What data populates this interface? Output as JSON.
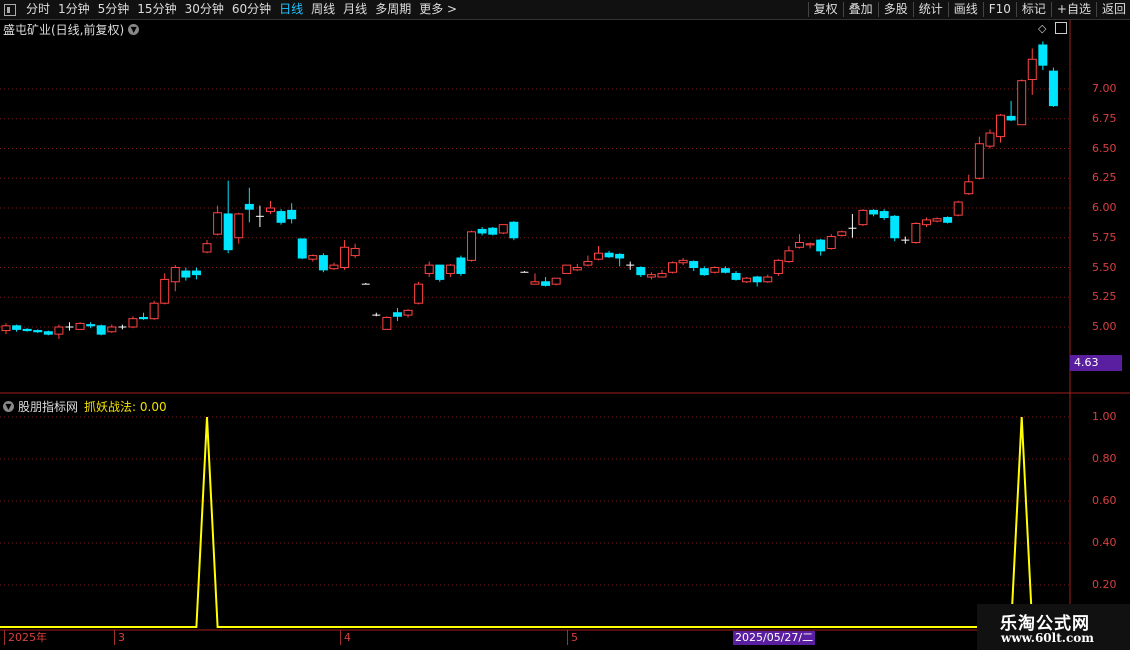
{
  "toolbar": {
    "periods": [
      "分时",
      "1分钟",
      "5分钟",
      "15分钟",
      "30分钟",
      "60分钟",
      "日线",
      "周线",
      "月线",
      "多周期",
      "更多 >"
    ],
    "active": "日线",
    "actions": [
      "复权",
      "叠加",
      "多股",
      "统计",
      "画线",
      "F10",
      "标记",
      "+自选",
      "返回"
    ]
  },
  "chart": {
    "stock_name": "盛屯矿业(日线,前复权)",
    "last_price_tag": "4.63",
    "price_axis": [
      "7.00",
      "6.75",
      "6.50",
      "6.25",
      "6.00",
      "5.75",
      "5.50",
      "5.25",
      "5.00"
    ],
    "indicator_name": "股朋指标网",
    "indicator_signal": "抓妖战法: 0.00",
    "indicator_axis": [
      "1.00",
      "0.80",
      "0.60",
      "0.40",
      "0.20"
    ],
    "date_labels": [
      "2025年",
      "3",
      "4",
      "5"
    ],
    "date_highlight": "2025/05/27/二",
    "colors": {
      "up": "#ff4444",
      "down": "#00e5ff",
      "signal": "#ffff00",
      "grid": "#7a1a1a"
    }
  },
  "chart_data": [
    {
      "type": "candlestick",
      "title": "盛屯矿业(日线,前复权)",
      "ylim": [
        4.63,
        7.35
      ],
      "candles": [
        {
          "o": 4.97,
          "c": 5.01,
          "h": 5.03,
          "l": 4.94
        },
        {
          "o": 5.01,
          "c": 4.98,
          "h": 5.02,
          "l": 4.96
        },
        {
          "o": 4.98,
          "c": 4.97,
          "h": 4.99,
          "l": 4.96
        },
        {
          "o": 4.97,
          "c": 4.96,
          "h": 4.98,
          "l": 4.95
        },
        {
          "o": 4.96,
          "c": 4.94,
          "h": 4.97,
          "l": 4.93
        },
        {
          "o": 4.94,
          "c": 5.0,
          "h": 5.02,
          "l": 4.9
        },
        {
          "o": 5.0,
          "c": 5.0,
          "h": 5.04,
          "l": 4.97
        },
        {
          "o": 4.98,
          "c": 5.03,
          "h": 5.04,
          "l": 4.98
        },
        {
          "o": 5.02,
          "c": 5.01,
          "h": 5.04,
          "l": 4.99
        },
        {
          "o": 5.01,
          "c": 4.94,
          "h": 5.02,
          "l": 4.93
        },
        {
          "o": 4.96,
          "c": 5.0,
          "h": 5.02,
          "l": 4.95
        },
        {
          "o": 5.0,
          "c": 5.0,
          "h": 5.02,
          "l": 4.98
        },
        {
          "o": 5.0,
          "c": 5.07,
          "h": 5.09,
          "l": 4.99
        },
        {
          "o": 5.08,
          "c": 5.07,
          "h": 5.12,
          "l": 5.06
        },
        {
          "o": 5.07,
          "c": 5.2,
          "h": 5.22,
          "l": 5.06
        },
        {
          "o": 5.2,
          "c": 5.4,
          "h": 5.45,
          "l": 5.19
        },
        {
          "o": 5.38,
          "c": 5.5,
          "h": 5.52,
          "l": 5.3
        },
        {
          "o": 5.47,
          "c": 5.42,
          "h": 5.5,
          "l": 5.39
        },
        {
          "o": 5.47,
          "c": 5.44,
          "h": 5.5,
          "l": 5.4
        },
        {
          "o": 5.63,
          "c": 5.7,
          "h": 5.73,
          "l": 5.62
        },
        {
          "o": 5.78,
          "c": 5.96,
          "h": 6.02,
          "l": 5.77
        },
        {
          "o": 5.95,
          "c": 5.65,
          "h": 6.23,
          "l": 5.62
        },
        {
          "o": 5.75,
          "c": 5.95,
          "h": 5.96,
          "l": 5.7
        },
        {
          "o": 6.03,
          "c": 5.99,
          "h": 6.17,
          "l": 5.88
        },
        {
          "o": 5.93,
          "c": 5.93,
          "h": 6.02,
          "l": 5.84
        },
        {
          "o": 5.97,
          "c": 6.0,
          "h": 6.06,
          "l": 5.95
        },
        {
          "o": 5.97,
          "c": 5.88,
          "h": 5.99,
          "l": 5.86
        },
        {
          "o": 5.98,
          "c": 5.91,
          "h": 6.04,
          "l": 5.87
        },
        {
          "o": 5.74,
          "c": 5.58,
          "h": 5.74,
          "l": 5.57
        },
        {
          "o": 5.57,
          "c": 5.6,
          "h": 5.61,
          "l": 5.55
        },
        {
          "o": 5.6,
          "c": 5.48,
          "h": 5.62,
          "l": 5.46
        },
        {
          "o": 5.49,
          "c": 5.52,
          "h": 5.54,
          "l": 5.48
        },
        {
          "o": 5.5,
          "c": 5.67,
          "h": 5.73,
          "l": 5.48
        },
        {
          "o": 5.6,
          "c": 5.66,
          "h": 5.7,
          "l": 5.58
        },
        {
          "o": 5.36,
          "c": 5.36,
          "h": 5.37,
          "l": 5.36
        },
        {
          "o": 5.1,
          "c": 5.1,
          "h": 5.12,
          "l": 5.09
        },
        {
          "o": 4.98,
          "c": 5.08,
          "h": 5.09,
          "l": 4.98
        },
        {
          "o": 5.12,
          "c": 5.09,
          "h": 5.16,
          "l": 5.05
        },
        {
          "o": 5.1,
          "c": 5.14,
          "h": 5.15,
          "l": 5.08
        },
        {
          "o": 5.2,
          "c": 5.36,
          "h": 5.38,
          "l": 5.19
        },
        {
          "o": 5.45,
          "c": 5.52,
          "h": 5.55,
          "l": 5.42
        },
        {
          "o": 5.52,
          "c": 5.4,
          "h": 5.52,
          "l": 5.38
        },
        {
          "o": 5.45,
          "c": 5.52,
          "h": 5.53,
          "l": 5.42
        },
        {
          "o": 5.58,
          "c": 5.45,
          "h": 5.6,
          "l": 5.43
        },
        {
          "o": 5.56,
          "c": 5.8,
          "h": 5.81,
          "l": 5.55
        },
        {
          "o": 5.82,
          "c": 5.79,
          "h": 5.84,
          "l": 5.77
        },
        {
          "o": 5.83,
          "c": 5.78,
          "h": 5.84,
          "l": 5.77
        },
        {
          "o": 5.79,
          "c": 5.86,
          "h": 5.86,
          "l": 5.78
        },
        {
          "o": 5.88,
          "c": 5.75,
          "h": 5.89,
          "l": 5.73
        },
        {
          "o": 5.46,
          "c": 5.46,
          "h": 5.47,
          "l": 5.46
        },
        {
          "o": 5.36,
          "c": 5.38,
          "h": 5.45,
          "l": 5.36
        },
        {
          "o": 5.38,
          "c": 5.35,
          "h": 5.42,
          "l": 5.34
        },
        {
          "o": 5.36,
          "c": 5.41,
          "h": 5.41,
          "l": 5.35
        },
        {
          "o": 5.45,
          "c": 5.52,
          "h": 5.52,
          "l": 5.45
        },
        {
          "o": 5.48,
          "c": 5.5,
          "h": 5.53,
          "l": 5.47
        },
        {
          "o": 5.52,
          "c": 5.55,
          "h": 5.6,
          "l": 5.51
        },
        {
          "o": 5.57,
          "c": 5.62,
          "h": 5.68,
          "l": 5.56
        },
        {
          "o": 5.62,
          "c": 5.59,
          "h": 5.64,
          "l": 5.58
        },
        {
          "o": 5.61,
          "c": 5.58,
          "h": 5.62,
          "l": 5.51
        },
        {
          "o": 5.52,
          "c": 5.52,
          "h": 5.55,
          "l": 5.48
        },
        {
          "o": 5.5,
          "c": 5.44,
          "h": 5.51,
          "l": 5.42
        },
        {
          "o": 5.42,
          "c": 5.44,
          "h": 5.46,
          "l": 5.4
        },
        {
          "o": 5.42,
          "c": 5.45,
          "h": 5.48,
          "l": 5.42
        },
        {
          "o": 5.46,
          "c": 5.54,
          "h": 5.55,
          "l": 5.45
        },
        {
          "o": 5.54,
          "c": 5.56,
          "h": 5.58,
          "l": 5.52
        },
        {
          "o": 5.55,
          "c": 5.5,
          "h": 5.56,
          "l": 5.47
        },
        {
          "o": 5.49,
          "c": 5.44,
          "h": 5.51,
          "l": 5.43
        },
        {
          "o": 5.46,
          "c": 5.5,
          "h": 5.51,
          "l": 5.45
        },
        {
          "o": 5.49,
          "c": 5.46,
          "h": 5.51,
          "l": 5.45
        },
        {
          "o": 5.45,
          "c": 5.4,
          "h": 5.47,
          "l": 5.39
        },
        {
          "o": 5.38,
          "c": 5.41,
          "h": 5.42,
          "l": 5.37
        },
        {
          "o": 5.42,
          "c": 5.38,
          "h": 5.43,
          "l": 5.34
        },
        {
          "o": 5.38,
          "c": 5.42,
          "h": 5.44,
          "l": 5.37
        },
        {
          "o": 5.45,
          "c": 5.56,
          "h": 5.57,
          "l": 5.43
        },
        {
          "o": 5.55,
          "c": 5.64,
          "h": 5.68,
          "l": 5.54
        },
        {
          "o": 5.67,
          "c": 5.71,
          "h": 5.78,
          "l": 5.66
        },
        {
          "o": 5.69,
          "c": 5.7,
          "h": 5.71,
          "l": 5.66
        },
        {
          "o": 5.73,
          "c": 5.64,
          "h": 5.74,
          "l": 5.6
        },
        {
          "o": 5.66,
          "c": 5.76,
          "h": 5.78,
          "l": 5.65
        },
        {
          "o": 5.77,
          "c": 5.8,
          "h": 5.81,
          "l": 5.76
        },
        {
          "o": 5.83,
          "c": 5.83,
          "h": 5.95,
          "l": 5.75
        },
        {
          "o": 5.86,
          "c": 5.98,
          "h": 5.99,
          "l": 5.85
        },
        {
          "o": 5.98,
          "c": 5.95,
          "h": 5.99,
          "l": 5.93
        },
        {
          "o": 5.97,
          "c": 5.92,
          "h": 5.99,
          "l": 5.9
        },
        {
          "o": 5.93,
          "c": 5.75,
          "h": 5.94,
          "l": 5.72
        },
        {
          "o": 5.73,
          "c": 5.73,
          "h": 5.76,
          "l": 5.7
        },
        {
          "o": 5.71,
          "c": 5.87,
          "h": 5.88,
          "l": 5.7
        },
        {
          "o": 5.86,
          "c": 5.9,
          "h": 5.92,
          "l": 5.84
        },
        {
          "o": 5.89,
          "c": 5.91,
          "h": 5.92,
          "l": 5.88
        },
        {
          "o": 5.92,
          "c": 5.88,
          "h": 5.93,
          "l": 5.87
        },
        {
          "o": 5.94,
          "c": 6.05,
          "h": 6.06,
          "l": 5.93
        },
        {
          "o": 6.12,
          "c": 6.22,
          "h": 6.28,
          "l": 6.11
        },
        {
          "o": 6.25,
          "c": 6.54,
          "h": 6.6,
          "l": 6.24
        },
        {
          "o": 6.52,
          "c": 6.63,
          "h": 6.66,
          "l": 6.5
        },
        {
          "o": 6.6,
          "c": 6.78,
          "h": 6.79,
          "l": 6.55
        },
        {
          "o": 6.77,
          "c": 6.74,
          "h": 6.9,
          "l": 6.73
        },
        {
          "o": 6.7,
          "c": 7.07,
          "h": 7.08,
          "l": 6.7
        },
        {
          "o": 7.08,
          "c": 7.25,
          "h": 7.34,
          "l": 6.95
        },
        {
          "o": 7.37,
          "c": 7.2,
          "h": 7.4,
          "l": 7.16
        },
        {
          "o": 7.15,
          "c": 6.86,
          "h": 7.18,
          "l": 6.85
        }
      ]
    },
    {
      "type": "line",
      "title": "抓妖战法",
      "ylim": [
        0,
        1.05
      ],
      "yticks": [
        1.0,
        0.8,
        0.6,
        0.4,
        0.2
      ],
      "series": [
        {
          "name": "抓妖战法",
          "values": [
            0,
            0,
            0,
            0,
            0,
            0,
            0,
            0,
            0,
            0,
            0,
            0,
            0,
            0,
            0,
            0,
            0,
            0,
            0,
            1,
            0,
            0,
            0,
            0,
            0,
            0,
            0,
            0,
            0,
            0,
            0,
            0,
            0,
            0,
            0,
            0,
            0,
            0,
            0,
            0,
            0,
            0,
            0,
            0,
            0,
            0,
            0,
            0,
            0,
            0,
            0,
            0,
            0,
            0,
            0,
            0,
            0,
            0,
            0,
            0,
            0,
            0,
            0,
            0,
            0,
            0,
            0,
            0,
            0,
            0,
            0,
            0,
            0,
            0,
            0,
            0,
            0,
            0,
            0,
            0,
            0,
            0,
            0,
            0,
            0,
            0,
            0,
            0,
            0,
            0,
            0,
            0,
            0,
            0,
            0,
            0,
            1,
            0,
            0,
            0
          ]
        }
      ]
    }
  ]
}
